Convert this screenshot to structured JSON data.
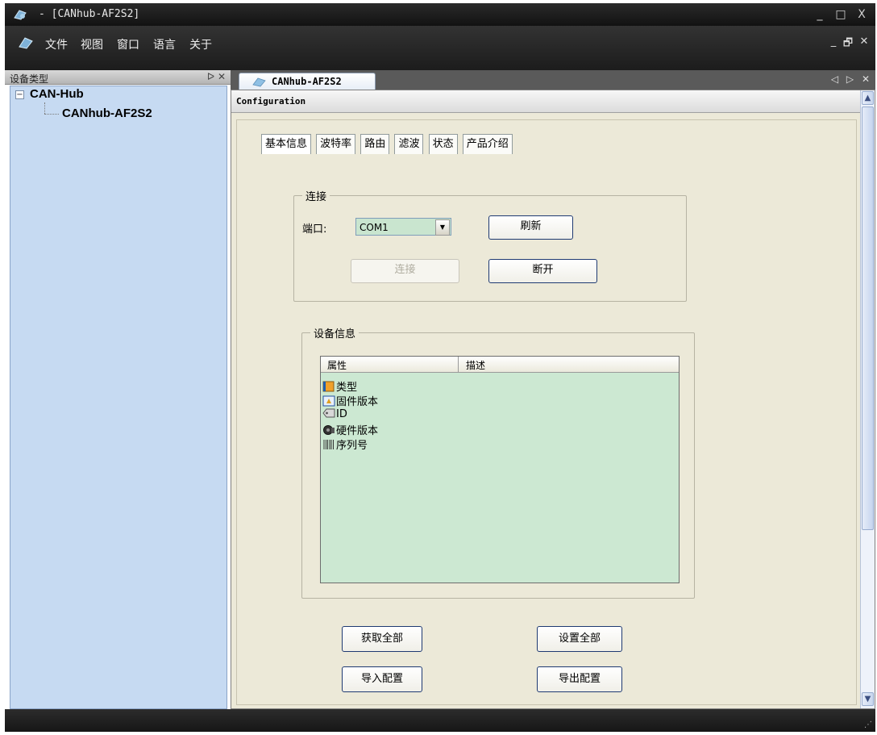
{
  "window": {
    "title": "- [CANhub-AF2S2]",
    "controls": {
      "minimize": "_",
      "maximize": "□",
      "close": "X"
    }
  },
  "menu": {
    "items": [
      "文件",
      "视图",
      "窗口",
      "语言",
      "关于"
    ],
    "mdi_controls": {
      "minimize": "_",
      "restore": "🗗",
      "close": "✕"
    }
  },
  "left_panel": {
    "title": "设备类型",
    "pin": "ᐅ",
    "close": "✕",
    "tree": {
      "expander": "−",
      "root": "CAN-Hub",
      "children": [
        "CANhub-AF2S2"
      ]
    }
  },
  "doc_tab": {
    "label": "CANhub-AF2S2",
    "nav": "◁ ▷ ✕"
  },
  "config": {
    "header": "Configuration",
    "tabs": [
      "基本信息",
      "波特率",
      "路由",
      "滤波",
      "状态",
      "产品介绍"
    ],
    "active_tab": "基本信息",
    "connect_group": {
      "title": "连接",
      "port_label": "端口:",
      "port_value": "COM1",
      "refresh_button": "刷新",
      "connect_button": "连接",
      "disconnect_button": "断开"
    },
    "device_info_group": {
      "title": "设备信息",
      "columns": [
        "属性",
        "描述"
      ],
      "rows": [
        {
          "icon": "type-icon",
          "label": "类型"
        },
        {
          "icon": "firmware-icon",
          "label": "固件版本"
        },
        {
          "icon": "id-tag-icon",
          "label": "ID"
        },
        {
          "icon": "hardware-icon",
          "label": "硬件版本"
        },
        {
          "icon": "barcode-icon",
          "label": "序列号"
        }
      ]
    },
    "get_all_button": "获取全部",
    "set_all_button": "设置全部",
    "import_button": "导入配置",
    "export_button": "导出配置"
  },
  "scrollbar": {
    "up": "▲",
    "down": "▼"
  }
}
